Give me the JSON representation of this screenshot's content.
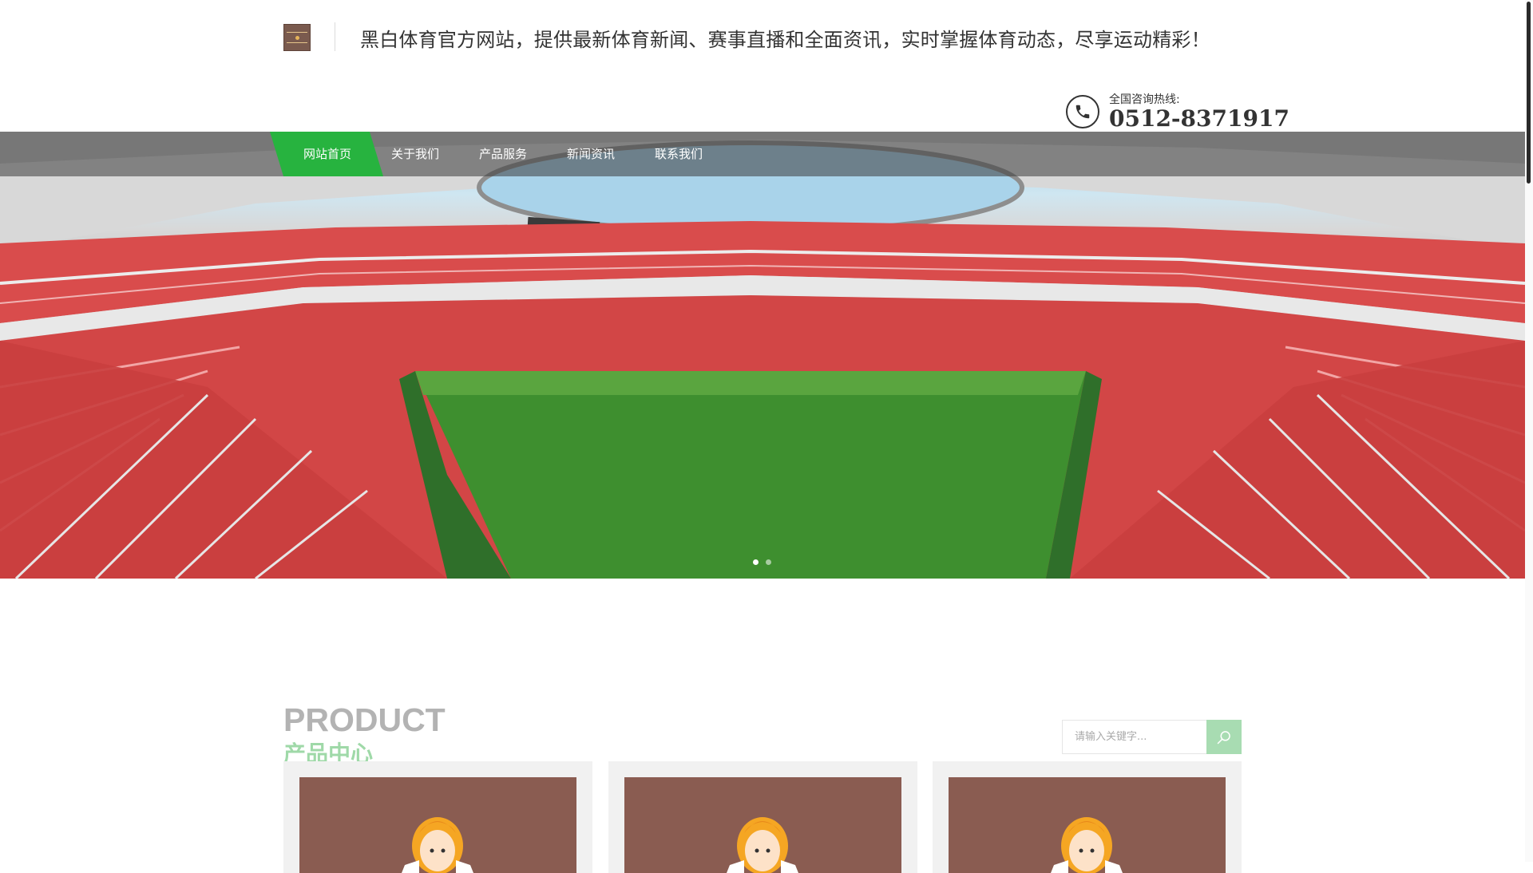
{
  "header": {
    "tagline": "黑白体育官方网站，提供最新体育新闻、赛事直播和全面资讯，实时掌握体育动态，尽享运动精彩！",
    "hotline_label": "全国咨询热线:",
    "hotline_number": "0512-8371917"
  },
  "nav": {
    "items": [
      {
        "label": "网站首页",
        "active": true
      },
      {
        "label": "关于我们",
        "active": false
      },
      {
        "label": "产品服务",
        "active": false
      },
      {
        "label": "新闻资讯",
        "active": false
      },
      {
        "label": "联系我们",
        "active": false
      }
    ],
    "active_color": "#27b33f"
  },
  "banner": {
    "slide_count": 2,
    "active_slide": 1
  },
  "products": {
    "title_en": "PRODUCT",
    "title_cn": "产品中心",
    "search_placeholder": "请输入关键字...",
    "cards": [
      {
        "image": "avatar-illustration"
      },
      {
        "image": "avatar-illustration"
      },
      {
        "image": "avatar-illustration"
      }
    ]
  },
  "colors": {
    "accent_green": "#27b33f",
    "search_button": "#a8dcb2",
    "card_image_bg": "#8a5c51"
  }
}
